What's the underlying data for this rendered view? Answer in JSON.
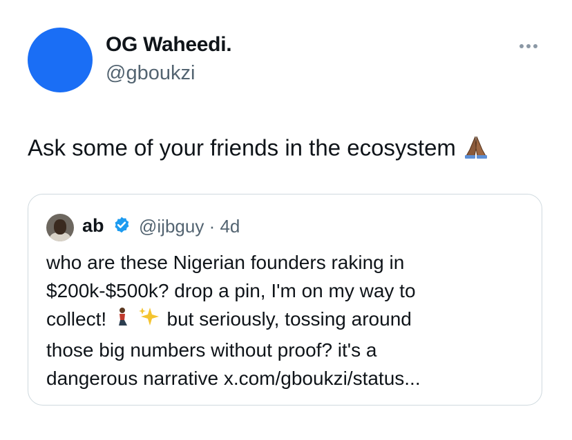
{
  "tweet": {
    "display_name": "OG Waheedi.",
    "handle": "@gboukzi",
    "avatar_color": "#1a6ef5",
    "text": "Ask some of your friends in the ecosystem",
    "text_emoji": "🙏🏾",
    "more_icon": "ellipsis-icon"
  },
  "quote": {
    "name": "ab",
    "verified": true,
    "handle": "@ijbguy",
    "separator": "·",
    "time": "4d",
    "lines": [
      "who are these Nigerian founders raking in",
      "$200k-$500k? drop a pin, I'm on my way to",
      "collect!",
      "but seriously, tossing around",
      "those big numbers without proof? it's a",
      "dangerous narrative x.com/gboukzi/status..."
    ],
    "emojis": [
      "🧎🏾",
      "✨"
    ],
    "accent_color": "#1d9bf0"
  }
}
